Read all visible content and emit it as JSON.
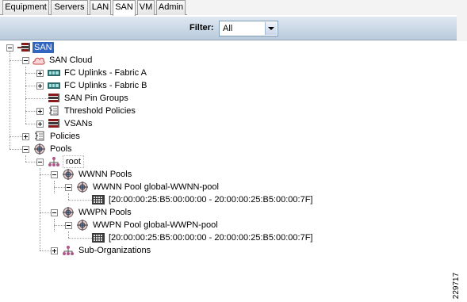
{
  "tabs": [
    {
      "label": "Equipment",
      "active": false
    },
    {
      "label": "Servers",
      "active": false
    },
    {
      "label": "LAN",
      "active": false
    },
    {
      "label": "SAN",
      "active": true
    },
    {
      "label": "VM",
      "active": false
    },
    {
      "label": "Admin",
      "active": false
    }
  ],
  "filter": {
    "label": "Filter:",
    "value": "All"
  },
  "tree": {
    "san": "SAN",
    "san_cloud": "SAN Cloud",
    "fc_uplinks_a": "FC Uplinks - Fabric A",
    "fc_uplinks_b": "FC Uplinks - Fabric B",
    "san_pin_groups": "SAN Pin Groups",
    "threshold_policies": "Threshold Policies",
    "vsans": "VSANs",
    "policies": "Policies",
    "pools": "Pools",
    "root": "root",
    "wwnn_pools": "WWNN Pools",
    "wwnn_pool_global": "WWNN Pool global-WWNN-pool",
    "wwnn_range": "[20:00:00:25:B5:00:00:00 - 20:00:00:25:B5:00:00:7F]",
    "wwpn_pools": "WWPN Pools",
    "wwpn_pool_global": "WWPN Pool global-WWPN-pool",
    "wwpn_range": "[20:00:00:25:B5:00:00:00 - 20:00:00:25:B5:00:00:7F]",
    "sub_organizations": "Sub-Organizations"
  },
  "icons": {
    "san": "san-stack-icon",
    "cloud": "cloud-icon",
    "fc_port": "fc-port-icon",
    "pin_group": "pin-group-icon",
    "policy": "policy-icon",
    "pool": "pool-target-icon",
    "org": "org-tree-icon",
    "block": "block-icon"
  },
  "figure_id": "229717"
}
